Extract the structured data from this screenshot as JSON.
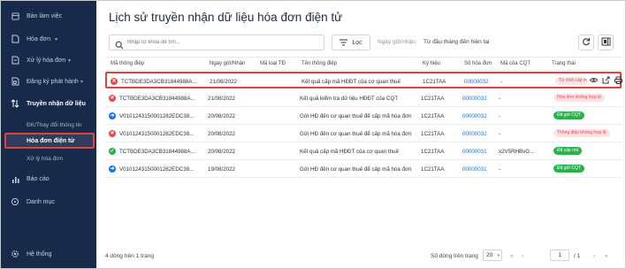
{
  "sidebar": {
    "items": [
      {
        "label": "Bàn làm việc",
        "icon": "desk-icon"
      },
      {
        "label": "Hóa đơn",
        "icon": "invoice-icon"
      },
      {
        "label": "Xử lý hóa đơn",
        "icon": "process-icon"
      },
      {
        "label": "Đăng ký phát hành",
        "icon": "register-icon"
      },
      {
        "label": "Truyền nhận dữ liệu",
        "icon": "transfer-icon"
      },
      {
        "label": "Báo cáo",
        "icon": "report-icon"
      },
      {
        "label": "Danh mục",
        "icon": "catalog-icon"
      },
      {
        "label": "Hệ thống",
        "icon": "system-icon"
      }
    ],
    "subitems": [
      {
        "label": "ĐK/Thay đổi thông tin"
      },
      {
        "label": "Hóa đơn điện tử"
      },
      {
        "label": "Xử lý hóa đơn"
      }
    ],
    "hoa_don_suffix": "▾"
  },
  "header": {
    "title": "Lịch sử truyền nhận dữ liệu hóa đơn điện tử",
    "search_placeholder": "Nhập từ khóa để tìm...",
    "filter_label": "Lọc",
    "send_date_label": "Ngày gửi/nhận:",
    "send_date_value": "Từ đầu tháng đến hiện tại"
  },
  "table": {
    "columns": [
      "Mã thông điệp",
      "Ngày gửi/Nhận",
      "Mã loại TĐ",
      "Tên thông điệp",
      "Ký hiệu",
      "Số hóa đơn",
      "Mã của CQT",
      "Trạng thái"
    ],
    "rows": [
      {
        "status_icon": "red",
        "code": "TCTBDE3DA3CB31844988A...",
        "date": "21/08/2022",
        "type": "",
        "name": "Kết quả cấp mã HĐĐT của cơ quan thuế",
        "symbol": "1C21TAA",
        "invoice_no": "00000032",
        "cqt_code": "-",
        "status": "Từ chối cấp mã",
        "status_color": "red"
      },
      {
        "status_icon": "red",
        "code": "TCTBDE3DA3CB31844988A...",
        "date": "21/08/2022",
        "type": "",
        "name": "Kết quả kiểm tra dữ liệu HĐĐT của CQT",
        "symbol": "1C21TAA",
        "invoice_no": "00000032",
        "cqt_code": "-",
        "status": "Hóa đơn không hợp lệ",
        "status_color": "red"
      },
      {
        "status_icon": "blue",
        "code": "V0101243150001282EDC38...",
        "date": "20/08/2022",
        "type": "",
        "name": "Gửi HĐ đến cơ quan thuế để cấp mã hóa đơn",
        "symbol": "1C21TAA",
        "invoice_no": "00000032",
        "cqt_code": "-",
        "status": "Đã gửi CQT",
        "status_color": "green"
      },
      {
        "status_icon": "red",
        "code": "V0101243150001282EDC38...",
        "date": "20/08/2022",
        "type": "",
        "name": "Gửi HĐ đến cơ quan thuế để cấp mã hóa đơn",
        "symbol": "1C21TAA",
        "invoice_no": "00000032",
        "cqt_code": "-",
        "status": "Thông điệp không hợp lệ",
        "status_color": "red"
      },
      {
        "status_icon": "green",
        "code": "TCTBDE3DA3CB31844988A...",
        "date": "20/08/2022",
        "type": "",
        "name": "Kết quả cấp mã HĐĐT của cơ quan thuế",
        "symbol": "1C21TAA",
        "invoice_no": "00000031",
        "cqt_code": "x2V5RHBvG...",
        "status": "Đã cấp mã",
        "status_color": "green"
      },
      {
        "status_icon": "blue",
        "code": "V0101243150001282EDC38...",
        "date": "19/08/2022",
        "type": "",
        "name": "Gửi HĐ đến cơ quan thuế để cấp mã hóa đơn",
        "symbol": "1C21TAA",
        "invoice_no": "00000031",
        "cqt_code": "-",
        "status": "Đã gửi CQT",
        "status_color": "green"
      }
    ]
  },
  "footer": {
    "total": "4 dòng trên 1 trang",
    "rows_per_page_label": "Số dòng trên trang",
    "rows_per_page": "20",
    "page": "1",
    "page_total": "/ 1"
  },
  "colors": {
    "sidebar_bg": "#172a4a",
    "accent": "#1a73e8",
    "highlight": "#e0423f",
    "success": "#2bb24c"
  }
}
